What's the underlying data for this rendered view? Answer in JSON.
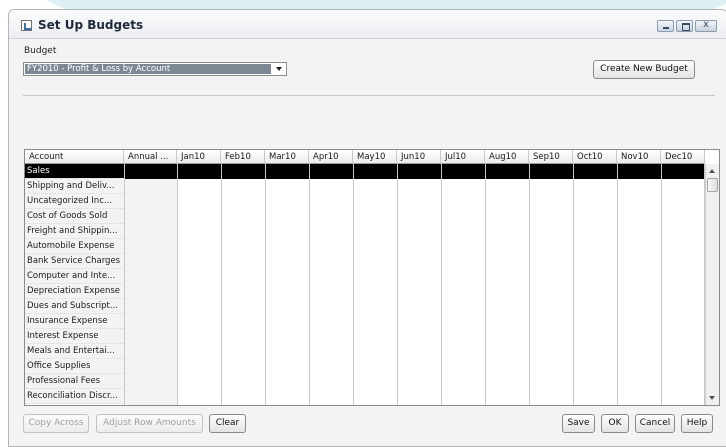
{
  "window": {
    "title": "Set Up Budgets"
  },
  "budget": {
    "label": "Budget",
    "selected": "FY2010 - Profit & Loss by Account",
    "create_label": "Create New Budget"
  },
  "grid": {
    "columns": [
      "Account",
      "Annual ...",
      "Jan10",
      "Feb10",
      "Mar10",
      "Apr10",
      "May10",
      "Jun10",
      "Jul10",
      "Aug10",
      "Sep10",
      "Oct10",
      "Nov10",
      "Dec10"
    ],
    "accounts": [
      "Sales",
      "Shipping and Deliv...",
      "Uncategorized Inc...",
      "Cost of Goods Sold",
      "Freight and Shippin...",
      "Automobile Expense",
      "Bank Service Charges",
      "Computer and Inte...",
      "Depreciation Expense",
      "Dues and Subscript...",
      "Insurance Expense",
      "Interest Expense",
      "Meals and Entertai...",
      "Office Supplies",
      "Professional Fees",
      "Reconciliation Discr..."
    ],
    "selected_row": "Sales"
  },
  "buttons": {
    "copy_across": "Copy Across",
    "adjust_row": "Adjust Row Amounts",
    "clear": "Clear",
    "save": "Save",
    "ok": "OK",
    "cancel": "Cancel",
    "help": "Help"
  }
}
